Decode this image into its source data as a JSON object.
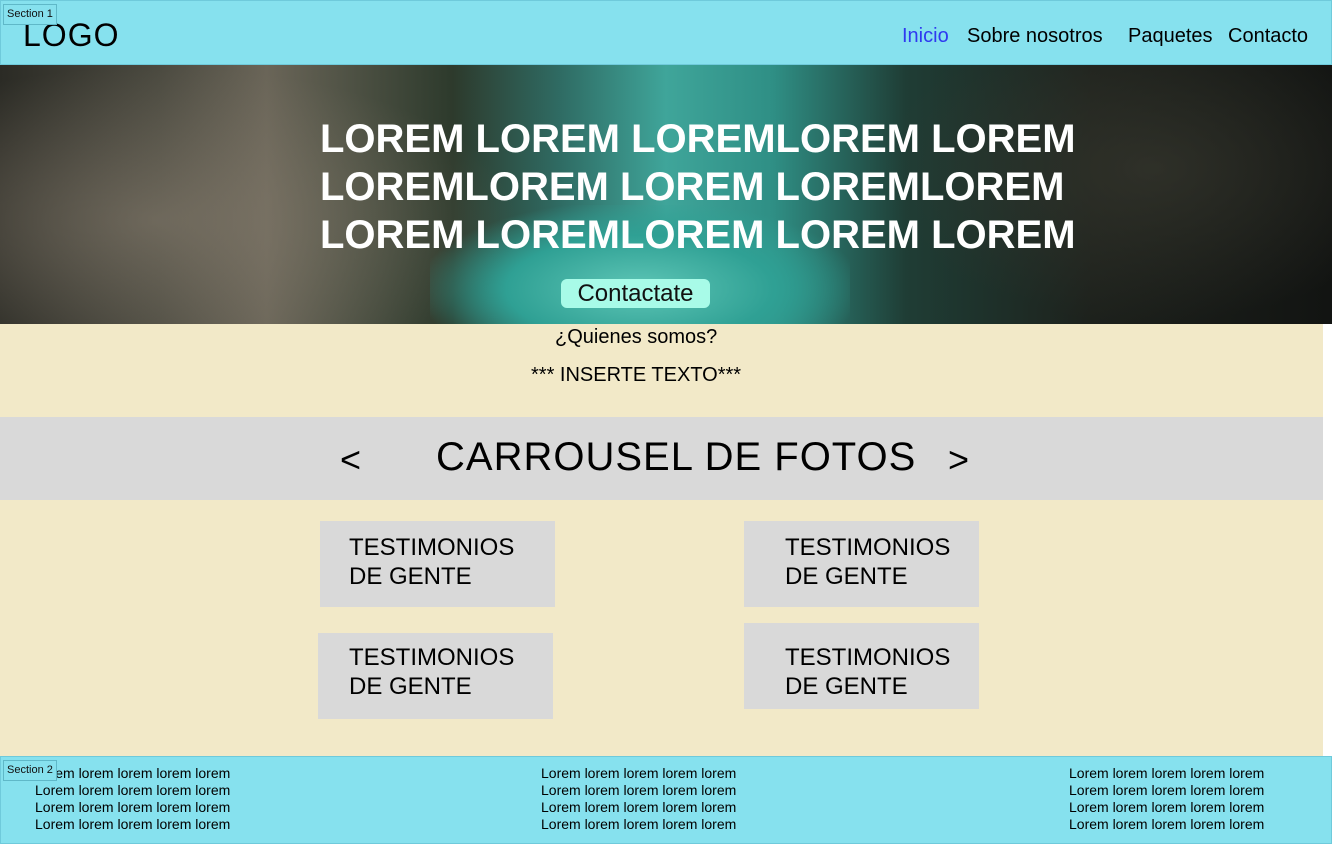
{
  "frames": {
    "section1": "Section 1",
    "section2": "Section 2"
  },
  "header": {
    "logo": "LOGO",
    "nav": [
      {
        "label": "Inicio",
        "active": true
      },
      {
        "label": "Sobre nosotros",
        "active": false
      },
      {
        "label": "Paquetes",
        "active": false
      },
      {
        "label": "Contacto",
        "active": false
      }
    ]
  },
  "hero": {
    "title_lines": [
      "LOREM LOREM LOREMLOREM LOREM",
      "LOREMLOREM LOREM LOREMLOREM",
      "LOREM LOREMLOREM LOREM LOREM"
    ],
    "cta_label": "Contactate"
  },
  "about": {
    "title": "¿Quienes somos?",
    "text": "*** INSERTE TEXTO***"
  },
  "carousel": {
    "prev": "<",
    "title": "CARROUSEL DE FOTOS",
    "next": ">"
  },
  "testimonials": [
    {
      "line1": "TESTIMONIOS",
      "line2": "DE GENTE"
    },
    {
      "line1": "TESTIMONIOS",
      "line2": "DE GENTE"
    },
    {
      "line1": "TESTIMONIOS",
      "line2": "DE GENTE"
    },
    {
      "line1": "TESTIMONIOS",
      "line2": "DE GENTE"
    }
  ],
  "footer": {
    "columns": [
      [
        "Lorem lorem lorem lorem lorem",
        "Lorem lorem lorem lorem lorem",
        "Lorem lorem lorem lorem lorem",
        "Lorem lorem lorem lorem lorem"
      ],
      [
        "Lorem lorem lorem lorem lorem",
        "Lorem lorem lorem lorem lorem",
        "Lorem lorem lorem lorem lorem",
        "Lorem lorem lorem lorem lorem"
      ],
      [
        "Lorem lorem lorem lorem lorem",
        "Lorem lorem lorem lorem lorem",
        "Lorem lorem lorem lorem lorem",
        "Lorem lorem lorem lorem lorem"
      ]
    ]
  },
  "colors": {
    "header_bg": "#86e1ee",
    "nav_active": "#2f3af0",
    "cta_bg": "#a8fbe8",
    "section_bg": "#f2e9c8",
    "block_gray": "#d9d9d9"
  }
}
